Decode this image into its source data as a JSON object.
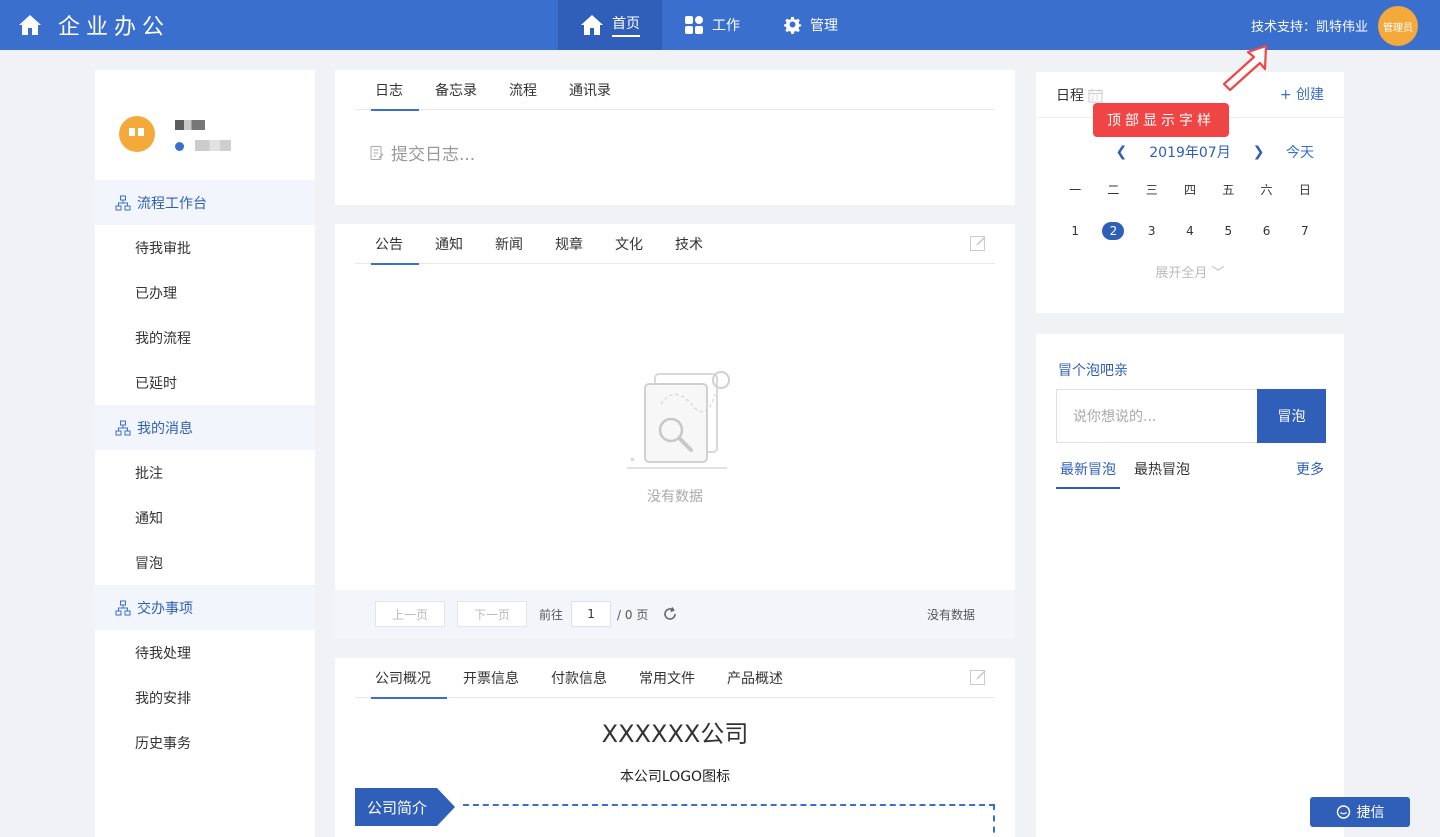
{
  "header": {
    "brand": "企业办公",
    "nav": [
      {
        "label": "首页",
        "icon": "home-icon",
        "active": true
      },
      {
        "label": "工作",
        "icon": "grid-icon",
        "active": false
      },
      {
        "label": "管理",
        "icon": "gear-icon",
        "active": false
      }
    ],
    "support": "技术支持：凯特伟业",
    "avatar_label": "管理员"
  },
  "sidebar": {
    "groups": [
      {
        "title": "流程工作台",
        "items": [
          "待我审批",
          "已办理",
          "我的流程",
          "已延时"
        ]
      },
      {
        "title": "我的消息",
        "items": [
          "批注",
          "通知",
          "冒泡"
        ]
      },
      {
        "title": "交办事项",
        "items": [
          "待我处理",
          "我的安排",
          "历史事务"
        ]
      }
    ]
  },
  "log_card": {
    "tabs": [
      "日志",
      "备忘录",
      "流程",
      "通讯录"
    ],
    "placeholder": "提交日志..."
  },
  "notice_card": {
    "tabs": [
      "公告",
      "通知",
      "新闻",
      "规章",
      "文化",
      "技术"
    ],
    "empty_text": "没有数据",
    "pager": {
      "prev": "上一页",
      "next": "下一页",
      "goto": "前往",
      "page": "1",
      "total": "/ 0 页",
      "status": "没有数据"
    }
  },
  "company_card": {
    "tabs": [
      "公司概况",
      "开票信息",
      "付款信息",
      "常用文件",
      "产品概述"
    ],
    "name": "XXXXXX公司",
    "logo_text": "本公司LOGO图标",
    "intro_label": "公司简介"
  },
  "calendar": {
    "title": "日程",
    "create": "+ 创建",
    "month": "2019年07月",
    "today": "今天",
    "weekdays": [
      "一",
      "二",
      "三",
      "四",
      "五",
      "六",
      "日"
    ],
    "days": [
      "1",
      "2",
      "3",
      "4",
      "5",
      "6",
      "7"
    ],
    "selected_day": "2",
    "expand": "展开全月"
  },
  "bubble": {
    "title": "冒个泡吧亲",
    "placeholder": "说你想说的...",
    "button": "冒泡",
    "tabs": [
      "最新冒泡",
      "最热冒泡"
    ],
    "more": "更多"
  },
  "annotation": "顶部显示字样",
  "chat_button": "捷信",
  "colors": {
    "primary": "#3a6fce",
    "primary_dark": "#2f5fb8",
    "avatar": "#f4a93b",
    "annotation": "#f04545"
  }
}
